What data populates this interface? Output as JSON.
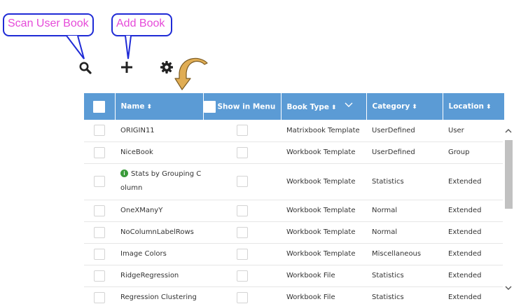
{
  "callouts": {
    "scan": "Scan User Book",
    "add": "Add Book"
  },
  "toolbar": {
    "search_icon": "search-icon",
    "add_icon": "plus-icon",
    "settings_icon": "gear-icon"
  },
  "colors": {
    "header_bg": "#5b9bd5",
    "callout_border": "#1f2bd6",
    "callout_text": "#e64ad9",
    "arrow": "#e0ad54",
    "info": "#3a9b3a"
  },
  "table": {
    "headers": {
      "name": "Name",
      "show_in_menu": "Show in Menu",
      "book_type": "Book Type",
      "category": "Category",
      "location": "Location",
      "sort_icon": "⬍"
    },
    "rows": [
      {
        "name": "ORIGIN11",
        "book_type": "Matrixbook Template",
        "category": "UserDefined",
        "location": "User"
      },
      {
        "name": "NiceBook",
        "book_type": "Workbook Template",
        "category": "UserDefined",
        "location": "Group"
      },
      {
        "name": "Stats by Grouping C",
        "name_line2": "olumn",
        "has_info": true,
        "book_type": "Workbook Template",
        "category": "Statistics",
        "location": "Extended"
      },
      {
        "name": "OneXManyY",
        "book_type": "Workbook Template",
        "category": "Normal",
        "location": "Extended"
      },
      {
        "name": "NoColumnLabelRows",
        "book_type": "Workbook Template",
        "category": "Normal",
        "location": "Extended"
      },
      {
        "name": "Image Colors",
        "book_type": "Workbook Template",
        "category": "Miscellaneous",
        "location": "Extended"
      },
      {
        "name": "RidgeRegression",
        "book_type": "Workbook File",
        "category": "Statistics",
        "location": "Extended"
      },
      {
        "name": "Regression Clustering",
        "book_type": "Workbook File",
        "category": "Statistics",
        "location": "Extended"
      }
    ]
  }
}
